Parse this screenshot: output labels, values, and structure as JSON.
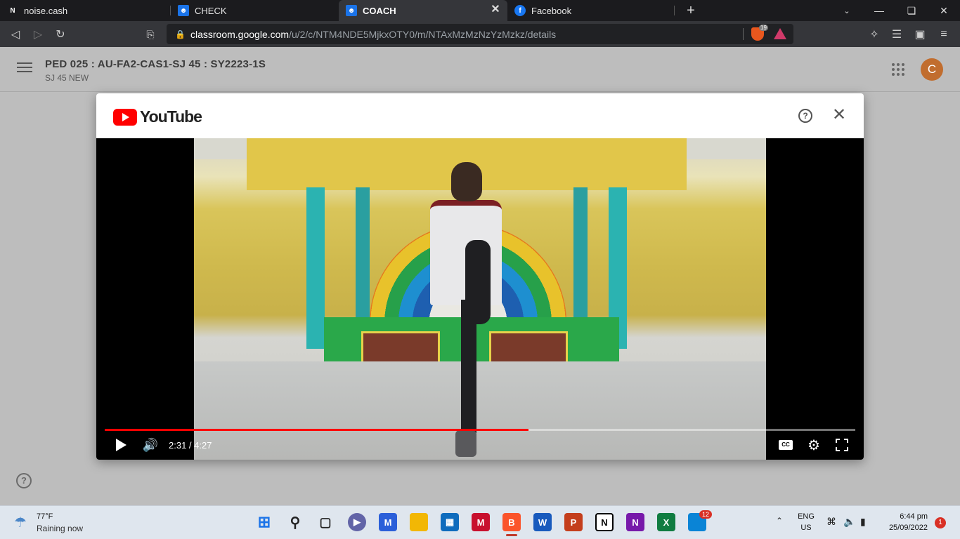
{
  "browser": {
    "tabs": [
      {
        "label": "noise.cash",
        "icon": "noise-cash-icon",
        "active": false
      },
      {
        "label": "CHECK",
        "icon": "classroom-icon",
        "active": false
      },
      {
        "label": "COACH",
        "icon": "classroom-icon",
        "active": true
      },
      {
        "label": "Facebook",
        "icon": "facebook-icon",
        "active": false
      }
    ],
    "new_tab_icon": "plus-icon",
    "url_host": "classroom.google.com",
    "url_path": "/u/2/c/NTM4NDE5MjkxOTY0/m/NTAxMzMzNzYzMzkz/details",
    "brave_shield_count": "19",
    "colors": {
      "tabstrip": "#1b1b1e",
      "toolbar": "#35363a",
      "omnibox": "#202124"
    }
  },
  "classroom": {
    "course_title": "PED 025 : AU-FA2-CAS1-SJ 45 : SY2223-1S",
    "course_subtitle": "SJ 45 NEW",
    "avatar_letter": "C",
    "avatar_color": "#c16d2e"
  },
  "youtube_modal": {
    "brand": "YouTube",
    "help_label": "?",
    "player": {
      "current_time": "2:31",
      "duration": "4:27",
      "time_separator": " / ",
      "progress_fraction": 0.565,
      "cc_label": "CC"
    }
  },
  "taskbar": {
    "weather_temp": "77°F",
    "weather_desc": "Raining now",
    "apps": [
      {
        "name": "windows-start",
        "label": ""
      },
      {
        "name": "search",
        "label": ""
      },
      {
        "name": "task-view",
        "label": ""
      },
      {
        "name": "chat",
        "label": ""
      },
      {
        "name": "app-m",
        "label": ""
      },
      {
        "name": "file-explorer",
        "label": ""
      },
      {
        "name": "microsoft-store",
        "label": ""
      },
      {
        "name": "mcafee",
        "label": ""
      },
      {
        "name": "brave",
        "label": ""
      },
      {
        "name": "word",
        "label": "W"
      },
      {
        "name": "powerpoint",
        "label": "P"
      },
      {
        "name": "notion",
        "label": "N"
      },
      {
        "name": "onenote",
        "label": "N"
      },
      {
        "name": "excel",
        "label": "X"
      },
      {
        "name": "messenger-app",
        "label": ""
      }
    ],
    "app_badge": "12",
    "language_line1": "ENG",
    "language_line2": "US",
    "time": "6:44 pm",
    "date": "25/09/2022",
    "notification_count": "1"
  }
}
